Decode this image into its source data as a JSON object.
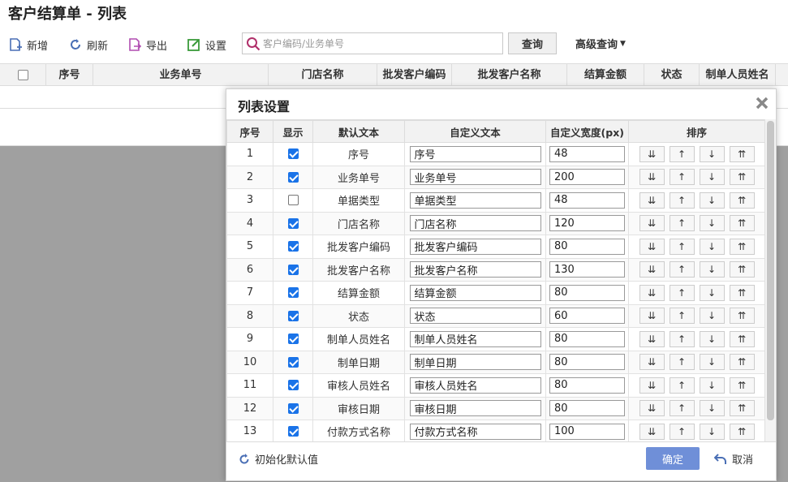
{
  "page": {
    "title": "客户结算单 - 列表"
  },
  "toolbar": {
    "add_label": "新增",
    "refresh_label": "刷新",
    "export_label": "导出",
    "settings_label": "设置",
    "search_placeholder": "客户编码/业务单号",
    "query_label": "查询",
    "advanced_label": "高级查询",
    "colors": {
      "add": "#4a6fb5",
      "refresh": "#4a6fb5",
      "export": "#b04cb0",
      "settings": "#3a9a3a",
      "search": "#b0306a"
    }
  },
  "grid": {
    "headers": [
      "序号",
      "业务单号",
      "门店名称",
      "批发客户编码",
      "批发客户名称",
      "结算金额",
      "状态",
      "制单人员姓名"
    ]
  },
  "dialog": {
    "title": "列表设置",
    "headers": [
      "序号",
      "显示",
      "默认文本",
      "自定义文本",
      "自定义宽度(px)",
      "排序"
    ],
    "sort_buttons": [
      "⇊",
      "↑",
      "↓",
      "⇈"
    ],
    "rows": [
      {
        "index": "1",
        "visible": true,
        "default_text": "序号",
        "custom_text": "序号",
        "width": "48"
      },
      {
        "index": "2",
        "visible": true,
        "default_text": "业务单号",
        "custom_text": "业务单号",
        "width": "200"
      },
      {
        "index": "3",
        "visible": false,
        "default_text": "单据类型",
        "custom_text": "单据类型",
        "width": "48"
      },
      {
        "index": "4",
        "visible": true,
        "default_text": "门店名称",
        "custom_text": "门店名称",
        "width": "120"
      },
      {
        "index": "5",
        "visible": true,
        "default_text": "批发客户编码",
        "custom_text": "批发客户编码",
        "width": "80"
      },
      {
        "index": "6",
        "visible": true,
        "default_text": "批发客户名称",
        "custom_text": "批发客户名称",
        "width": "130"
      },
      {
        "index": "7",
        "visible": true,
        "default_text": "结算金额",
        "custom_text": "结算金额",
        "width": "80"
      },
      {
        "index": "8",
        "visible": true,
        "default_text": "状态",
        "custom_text": "状态",
        "width": "60"
      },
      {
        "index": "9",
        "visible": true,
        "default_text": "制单人员姓名",
        "custom_text": "制单人员姓名",
        "width": "80"
      },
      {
        "index": "10",
        "visible": true,
        "default_text": "制单日期",
        "custom_text": "制单日期",
        "width": "80"
      },
      {
        "index": "11",
        "visible": true,
        "default_text": "审核人员姓名",
        "custom_text": "审核人员姓名",
        "width": "80"
      },
      {
        "index": "12",
        "visible": true,
        "default_text": "审核日期",
        "custom_text": "审核日期",
        "width": "80"
      },
      {
        "index": "13",
        "visible": true,
        "default_text": "付款方式名称",
        "custom_text": "付款方式名称",
        "width": "100"
      }
    ],
    "reset_label": "初始化默认值",
    "ok_label": "确定",
    "cancel_label": "取消"
  }
}
